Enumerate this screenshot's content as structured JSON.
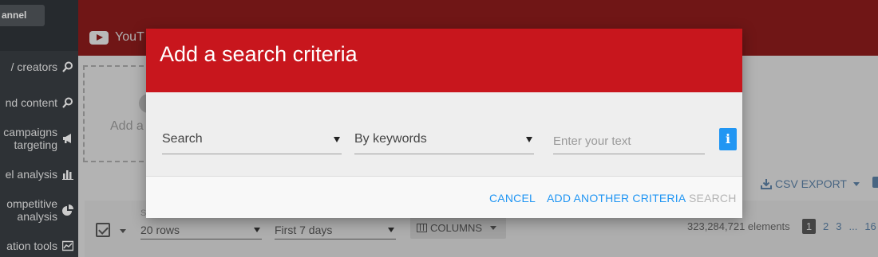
{
  "sidebar": {
    "channel_button": "annel",
    "items": [
      {
        "label": "/ creators",
        "icon": "search-icon"
      },
      {
        "label": "nd content",
        "icon": "search-icon"
      },
      {
        "label": "campaigns\ntargeting",
        "icon": "megaphone-icon"
      },
      {
        "label": "el analysis",
        "icon": "bar-chart-icon"
      },
      {
        "label": "ompetitive\nanalysis",
        "icon": "pie-chart-icon"
      },
      {
        "label": "ation tools",
        "icon": "line-chart-icon"
      }
    ]
  },
  "header": {
    "tab_label": "YouT",
    "tab_icon": "youtube-icon"
  },
  "main": {
    "add_label": "Add a",
    "csv_export": "CSV EXPORT",
    "rows_label": "Sh",
    "rows_value": "20 rows",
    "period_value": "First 7 days",
    "columns_label": "COLUMNS",
    "elements_count": "323,284,721 elements",
    "pages": [
      "1",
      "2",
      "3",
      "...",
      "16"
    ]
  },
  "modal": {
    "title": "Add a search criteria",
    "field_select": "Search",
    "mode_select": "By keywords",
    "text_placeholder": "Enter your text",
    "info_glyph": "i",
    "cancel": "CANCEL",
    "add_another": "ADD ANOTHER CRITERIA",
    "search": "SEARCH"
  },
  "colors": {
    "modal_header": "#c8161d",
    "accent_blue": "#2196f3",
    "disabled": "#b4b4b4"
  }
}
